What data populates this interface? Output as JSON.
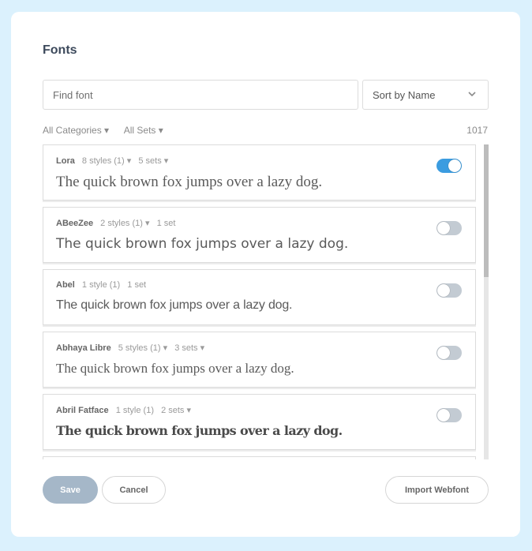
{
  "dialog": {
    "title": "Fonts"
  },
  "search": {
    "placeholder": "Find font",
    "value": ""
  },
  "sort": {
    "selected": "Sort by Name",
    "icon": "chevron-down-icon"
  },
  "filters": {
    "categories": "All Categories ▾",
    "sets": "All Sets ▾",
    "count": "1017"
  },
  "fonts": [
    {
      "name": "Lora",
      "styles": "8 styles (1) ▾",
      "sets": "5 sets ▾",
      "sample": "The quick brown fox jumps over a lazy dog.",
      "enabled": true
    },
    {
      "name": "ABeeZee",
      "styles": "2 styles (1) ▾",
      "sets": "1 set",
      "sample": "The quick brown fox jumps over a lazy dog.",
      "enabled": false
    },
    {
      "name": "Abel",
      "styles": "1 style (1)",
      "sets": "1 set",
      "sample": "The quick brown fox jumps over a lazy dog.",
      "enabled": false
    },
    {
      "name": "Abhaya Libre",
      "styles": "5 styles (1) ▾",
      "sets": "3 sets ▾",
      "sample": "The quick brown fox jumps over a lazy dog.",
      "enabled": false
    },
    {
      "name": "Abril Fatface",
      "styles": "1 style (1)",
      "sets": "2 sets ▾",
      "sample": "The quick brown fox jumps over a lazy dog.",
      "enabled": false
    }
  ],
  "colors": {
    "accent": "#3b9ce0",
    "toggle_off": "#c3cbd3",
    "save_disabled": "#a5b7c8",
    "background": "#dbf1fd"
  },
  "footer": {
    "save_label": "Save",
    "cancel_label": "Cancel",
    "import_label": "Import Webfont"
  }
}
